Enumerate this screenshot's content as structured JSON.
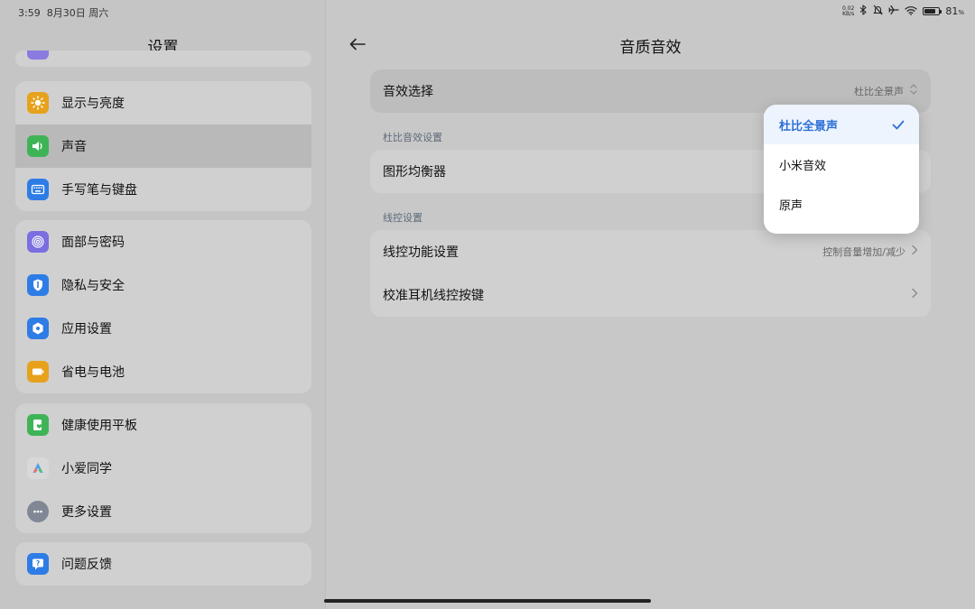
{
  "status": {
    "time": "3:59",
    "date": "8月30日 周六",
    "rate_top": "0.02",
    "rate_bottom": "KB/s",
    "battery": "81",
    "battery_unit": "%",
    "battery_level": 0.81
  },
  "left": {
    "title": "设置",
    "groups": [
      [
        {
          "label": "显示与亮度",
          "icon": "sun-icon",
          "color": "#e6a21c"
        },
        {
          "label": "声音",
          "icon": "speaker-icon",
          "color": "#3fb457",
          "selected": true
        },
        {
          "label": "手写笔与键盘",
          "icon": "keyboard-icon",
          "color": "#2e7ce6"
        }
      ],
      [
        {
          "label": "面部与密码",
          "icon": "fingerprint-icon",
          "color": "#7a6ee0"
        },
        {
          "label": "隐私与安全",
          "icon": "shield-icon",
          "color": "#2e7ce6"
        },
        {
          "label": "应用设置",
          "icon": "app-icon",
          "color": "#2e7ce6"
        },
        {
          "label": "省电与电池",
          "icon": "battery-icon",
          "color": "#e6a21c"
        }
      ],
      [
        {
          "label": "健康使用平板",
          "icon": "health-icon",
          "color": "#3fb457"
        },
        {
          "label": "小爱同学",
          "icon": "xiaoai-icon",
          "color": "#4aa3f0"
        },
        {
          "label": "更多设置",
          "icon": "more-icon",
          "color": "#7f8894"
        }
      ],
      [
        {
          "label": "问题反馈",
          "icon": "feedback-icon",
          "color": "#2e7ce6"
        }
      ]
    ]
  },
  "right": {
    "title": "音质音效",
    "effect_row": {
      "label": "音效选择",
      "value": "杜比全景声"
    },
    "section_dolby": "杜比音效设置",
    "eq_row": {
      "label": "图形均衡器"
    },
    "section_wire": "线控设置",
    "wire_rows": [
      {
        "label": "线控功能设置",
        "value": "控制音量增加/减少"
      },
      {
        "label": "校准耳机线控按键",
        "value": ""
      }
    ]
  },
  "popup": {
    "options": [
      {
        "label": "杜比全景声",
        "selected": true
      },
      {
        "label": "小米音效",
        "selected": false
      },
      {
        "label": "原声",
        "selected": false
      }
    ]
  }
}
